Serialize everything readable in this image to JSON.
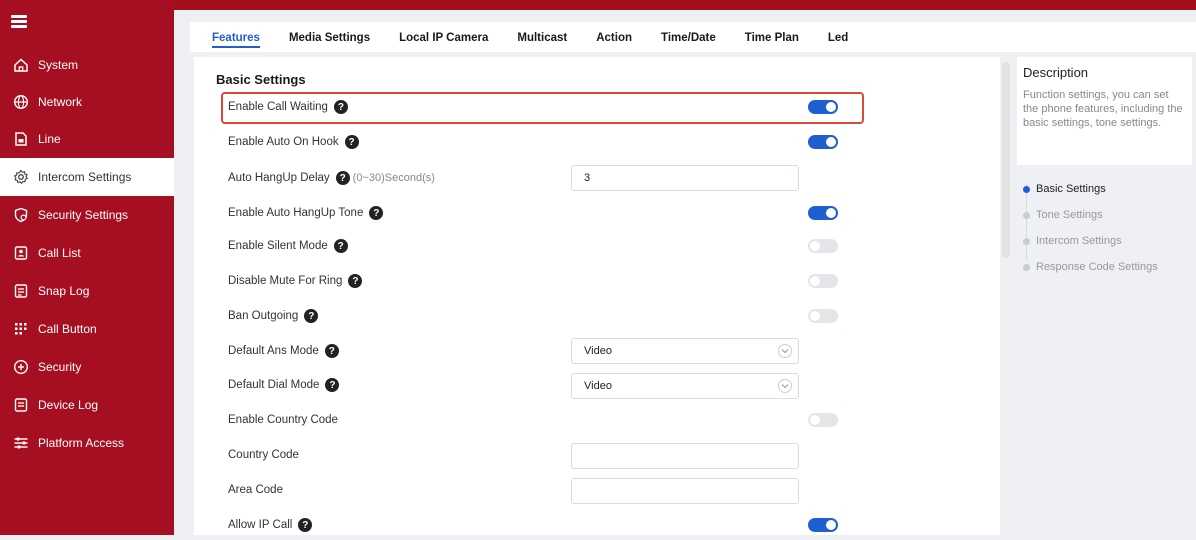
{
  "sidebar": {
    "items": [
      {
        "label": "System",
        "icon": "home-icon"
      },
      {
        "label": "Network",
        "icon": "globe-icon"
      },
      {
        "label": "Line",
        "icon": "sim-card-icon"
      },
      {
        "label": "Intercom Settings",
        "icon": "gear-icon"
      },
      {
        "label": "Security Settings",
        "icon": "shield-icon"
      },
      {
        "label": "Call List",
        "icon": "contact-book-icon"
      },
      {
        "label": "Snap Log",
        "icon": "log-icon"
      },
      {
        "label": "Call Button",
        "icon": "keypad-icon"
      },
      {
        "label": "Security",
        "icon": "plus-shield-icon"
      },
      {
        "label": "Device Log",
        "icon": "document-icon"
      },
      {
        "label": "Platform Access",
        "icon": "sliders-icon"
      }
    ],
    "active_index": 3
  },
  "tabs": [
    "Features",
    "Media Settings",
    "Local IP Camera",
    "Multicast",
    "Action",
    "Time/Date",
    "Time Plan",
    "Led"
  ],
  "active_tab": 0,
  "section_title": "Basic Settings",
  "settings": {
    "enable_call_waiting": {
      "label": "Enable Call Waiting",
      "on": true
    },
    "enable_auto_on_hook": {
      "label": "Enable Auto On Hook",
      "on": true
    },
    "auto_hangup_delay": {
      "label": "Auto HangUp Delay",
      "hint": "(0~30)Second(s)",
      "value": "3"
    },
    "enable_auto_hangup_tone": {
      "label": "Enable Auto HangUp Tone",
      "on": true
    },
    "enable_silent_mode": {
      "label": "Enable Silent Mode",
      "on": false
    },
    "disable_mute_for_ring": {
      "label": "Disable Mute For Ring",
      "on": false
    },
    "ban_outgoing": {
      "label": "Ban Outgoing",
      "on": false
    },
    "default_ans_mode": {
      "label": "Default Ans Mode",
      "value": "Video"
    },
    "default_dial_mode": {
      "label": "Default Dial Mode",
      "value": "Video"
    },
    "enable_country_code": {
      "label": "Enable Country Code",
      "on": false
    },
    "country_code": {
      "label": "Country Code",
      "value": ""
    },
    "area_code": {
      "label": "Area Code",
      "value": ""
    },
    "allow_ip_call": {
      "label": "Allow IP Call",
      "on": true
    }
  },
  "help_glyph": "?",
  "description": {
    "title": "Description",
    "text": "Function settings, you can set the phone features, including the basic settings, tone settings."
  },
  "anchors": [
    "Basic Settings",
    "Tone Settings",
    "Intercom Settings",
    "Response Code Settings"
  ],
  "colors": {
    "brand": "#a60f21",
    "accent": "#1f5fd1",
    "highlight": "#d94a3a"
  }
}
